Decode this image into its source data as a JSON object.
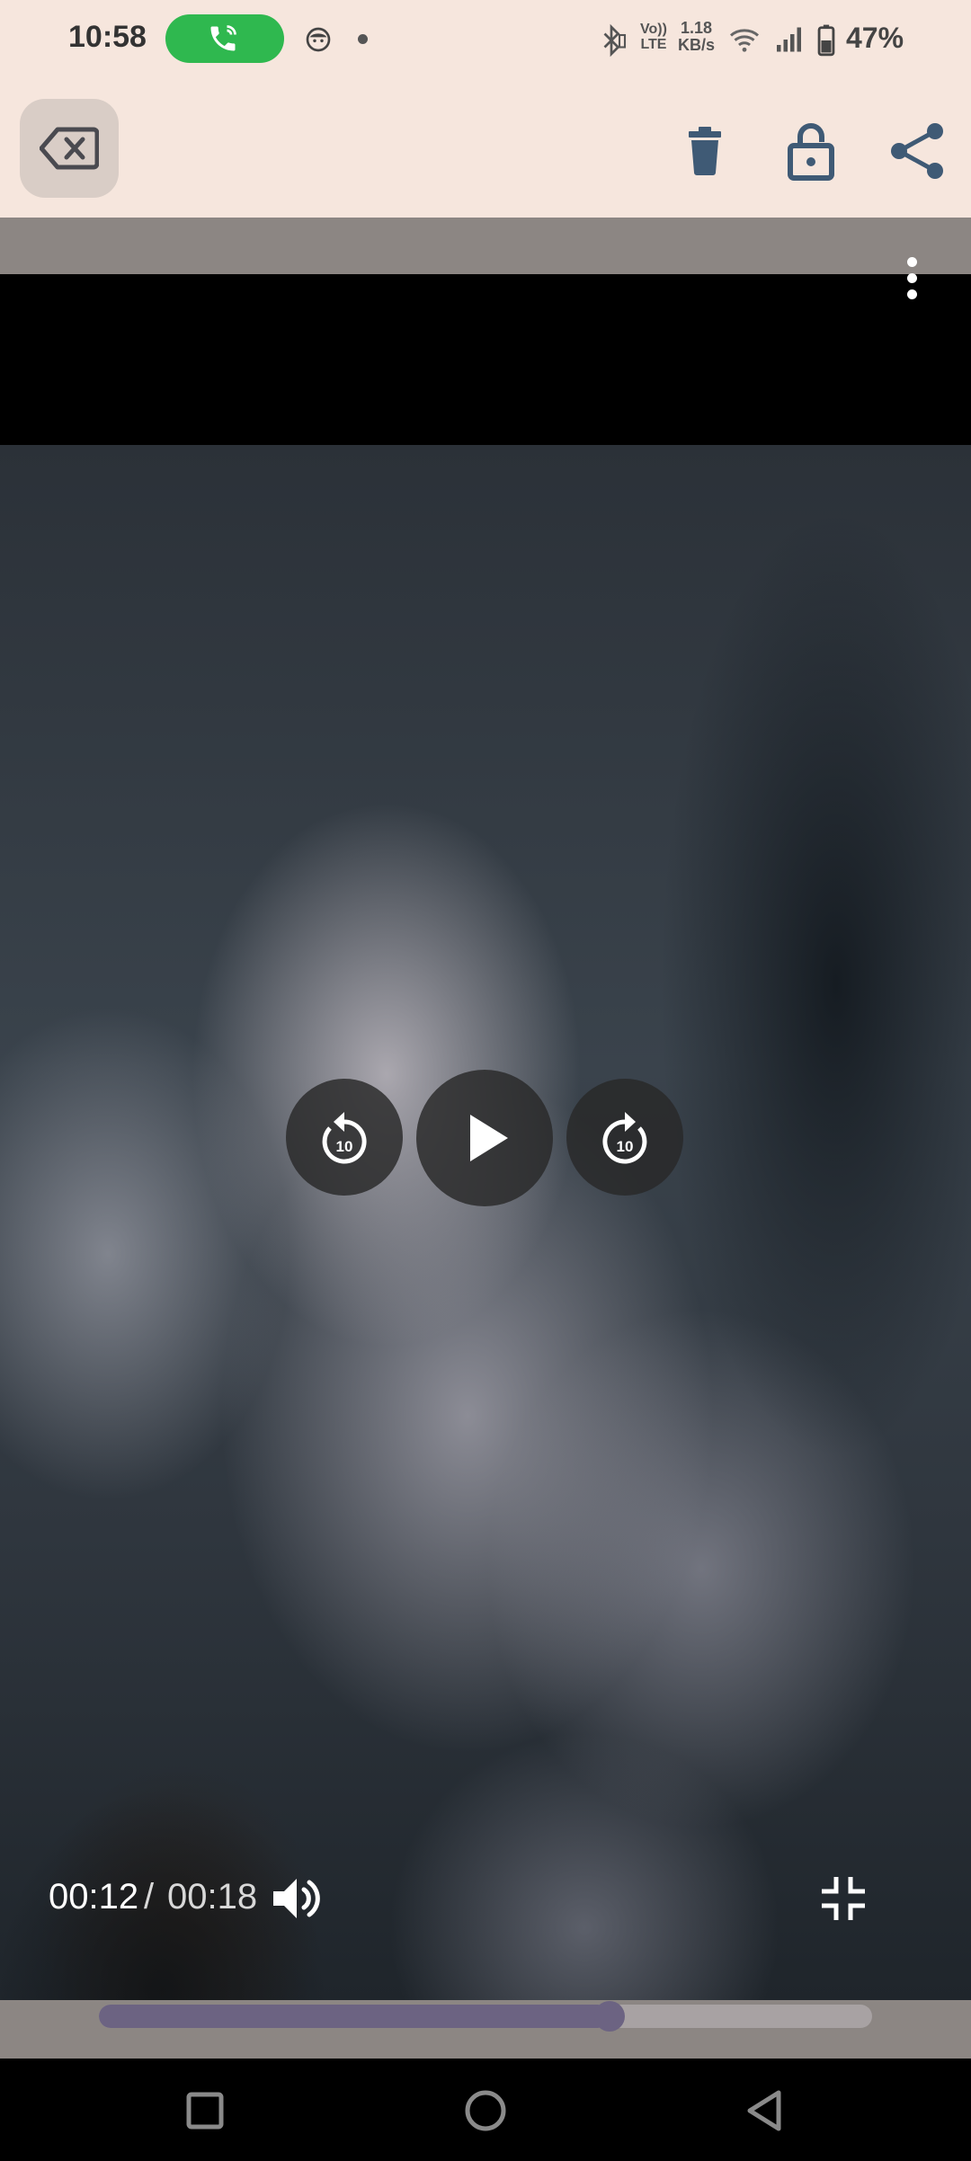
{
  "status_bar": {
    "time": "10:58",
    "speed_value": "1.18",
    "speed_unit": "KB/s",
    "volte_line1": "Vo))",
    "volte_line2": "LTE",
    "battery_percent": "47%",
    "icons": [
      "phone-call-icon",
      "face-notification-icon",
      "dot-icon",
      "bluetooth-icon",
      "volte-icon",
      "wifi-icon",
      "signal-icon",
      "battery-icon"
    ],
    "call_color": "#2fb84f"
  },
  "toolbar": {
    "icons": [
      "backspace-close-icon",
      "trash-icon",
      "lock-icon",
      "share-icon"
    ]
  },
  "player": {
    "current_time": "00:12",
    "separator": "/",
    "total_time": "00:18",
    "rewind_seconds": "10",
    "forward_seconds": "10",
    "progress_fraction": 0.66,
    "accent_color": "#6c6382",
    "icons": [
      "more-vertical-icon",
      "rewind-10-icon",
      "play-icon",
      "forward-10-icon",
      "volume-icon",
      "minimize-icon"
    ]
  },
  "navigation": {
    "icons": [
      "recents-square-icon",
      "home-circle-icon",
      "back-triangle-icon"
    ]
  }
}
